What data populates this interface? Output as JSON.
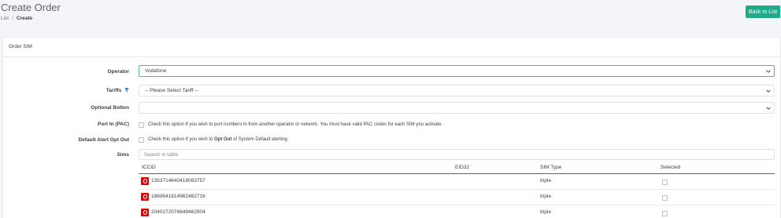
{
  "header": {
    "title": "Create Order",
    "breadcrumb": [
      {
        "label": "List"
      },
      {
        "label": "Create"
      }
    ],
    "back_button": "Back to List"
  },
  "card": {
    "title": "Order SIM",
    "operator": {
      "label": "Operator",
      "value": "Vodafone"
    },
    "tariffs": {
      "label": "Tariffs",
      "value": "-- Please Select Tariff --"
    },
    "bolton": {
      "label": "Optional Bolton",
      "value": ""
    },
    "port_in": {
      "label": "Port In (PAC)",
      "help": "Check this option if you wish to port numbers in from another operator or network. You must have valid PAC codes for each SIM you activate."
    },
    "alert_opt_out": {
      "label": "Default Alert Opt Out",
      "help_before": "Check this option if you wish to ",
      "help_bold": "Opt Out",
      "help_after": " of System Default alerting."
    },
    "sims": {
      "label": "Sims",
      "search_placeholder": "Search in table",
      "columns": [
        "ICCID",
        "EID32",
        "SIM Type",
        "Selected"
      ],
      "rows": [
        {
          "iccid": "1353714640418083757",
          "eid": "",
          "sim_type": "triple"
        },
        {
          "iccid": "1869641814962462716",
          "eid": "",
          "sim_type": "triple"
        },
        {
          "iccid": "2040272074849462904",
          "eid": "",
          "sim_type": "triple"
        }
      ]
    }
  },
  "colors": {
    "accent": "#1fab89",
    "vodafone_red": "#e60000",
    "filter_icon": "#1a73e8"
  },
  "icons": {
    "chevron": "chevron-down-icon",
    "filter": "filter-icon",
    "sim_logo": "vodafone-logo-icon"
  }
}
